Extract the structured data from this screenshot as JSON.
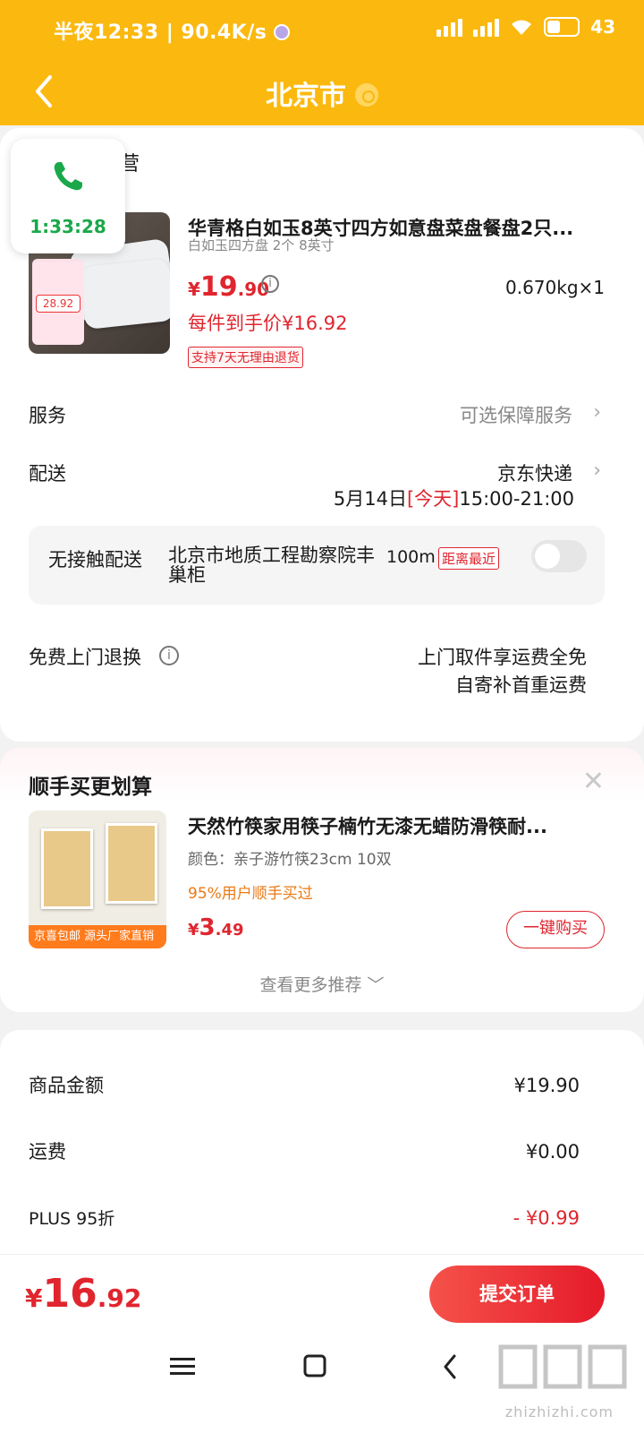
{
  "status_bar": {
    "time": "半夜12:33",
    "speed": "90.4K/s",
    "battery": "43"
  },
  "header": {
    "title": "北京市"
  },
  "call_widget": {
    "duration": "1:33:28"
  },
  "store": {
    "name_tail": "营"
  },
  "product": {
    "title": "华青格白如玉8英寸四方如意盘菜盘餐盘2只...",
    "spec": "白如玉四方盘 2个 8英寸",
    "price_symbol": "¥",
    "price_int": "19",
    "price_dec": ".90",
    "weight_qty": "0.670kg×1",
    "unit_price": "每件到手价¥16.92",
    "return_policy": "支持7天无理由退货",
    "image_price": "28.92"
  },
  "service": {
    "label": "服务",
    "value": "可选保障服务"
  },
  "delivery": {
    "label": "配送",
    "carrier": "京东快递",
    "date": "5月14日",
    "today_tag": "[今天]",
    "time_window": "15:00-21:00"
  },
  "contactless": {
    "label": "无接触配送",
    "address": "北京市地质工程勘察院丰巢柜",
    "distance": "100m",
    "tag": "距离最近",
    "enabled": false
  },
  "free_return": {
    "label": "免费上门退换",
    "line1": "上门取件享运费全免",
    "line2": "自寄补首重运费"
  },
  "recommend": {
    "title": "顺手买更划算",
    "item": {
      "name": "天然竹筷家用筷子楠竹无漆无蜡防滑筷耐...",
      "spec": "颜色：亲子游竹筷23cm 10双",
      "buyers": "95%用户顺手买过",
      "price_symbol": "¥",
      "price_int": "3",
      "price_dec": ".49",
      "buy_label": "一键购买",
      "img_footer_left": "京喜包邮",
      "img_footer_right": "源头厂家直销"
    },
    "more_label": "查看更多推荐 ﹀"
  },
  "amounts": [
    {
      "label": "商品金额",
      "value": "¥19.90",
      "negative": false
    },
    {
      "label": "运费",
      "value": "¥0.00",
      "negative": false
    },
    {
      "label": "PLUS 95折",
      "value": "- ¥0.99",
      "negative": true
    }
  ],
  "footer": {
    "total_symbol": "¥",
    "total_int": "16",
    "total_dec": ".92",
    "submit_label": "提交订单"
  },
  "watermark": {
    "text": "zhizhizhi.com"
  },
  "colors": {
    "brand_yellow": "#fbb90f",
    "price_red": "#e0252e",
    "call_green": "#1aa84a",
    "buyer_orange": "#ea7a14"
  }
}
